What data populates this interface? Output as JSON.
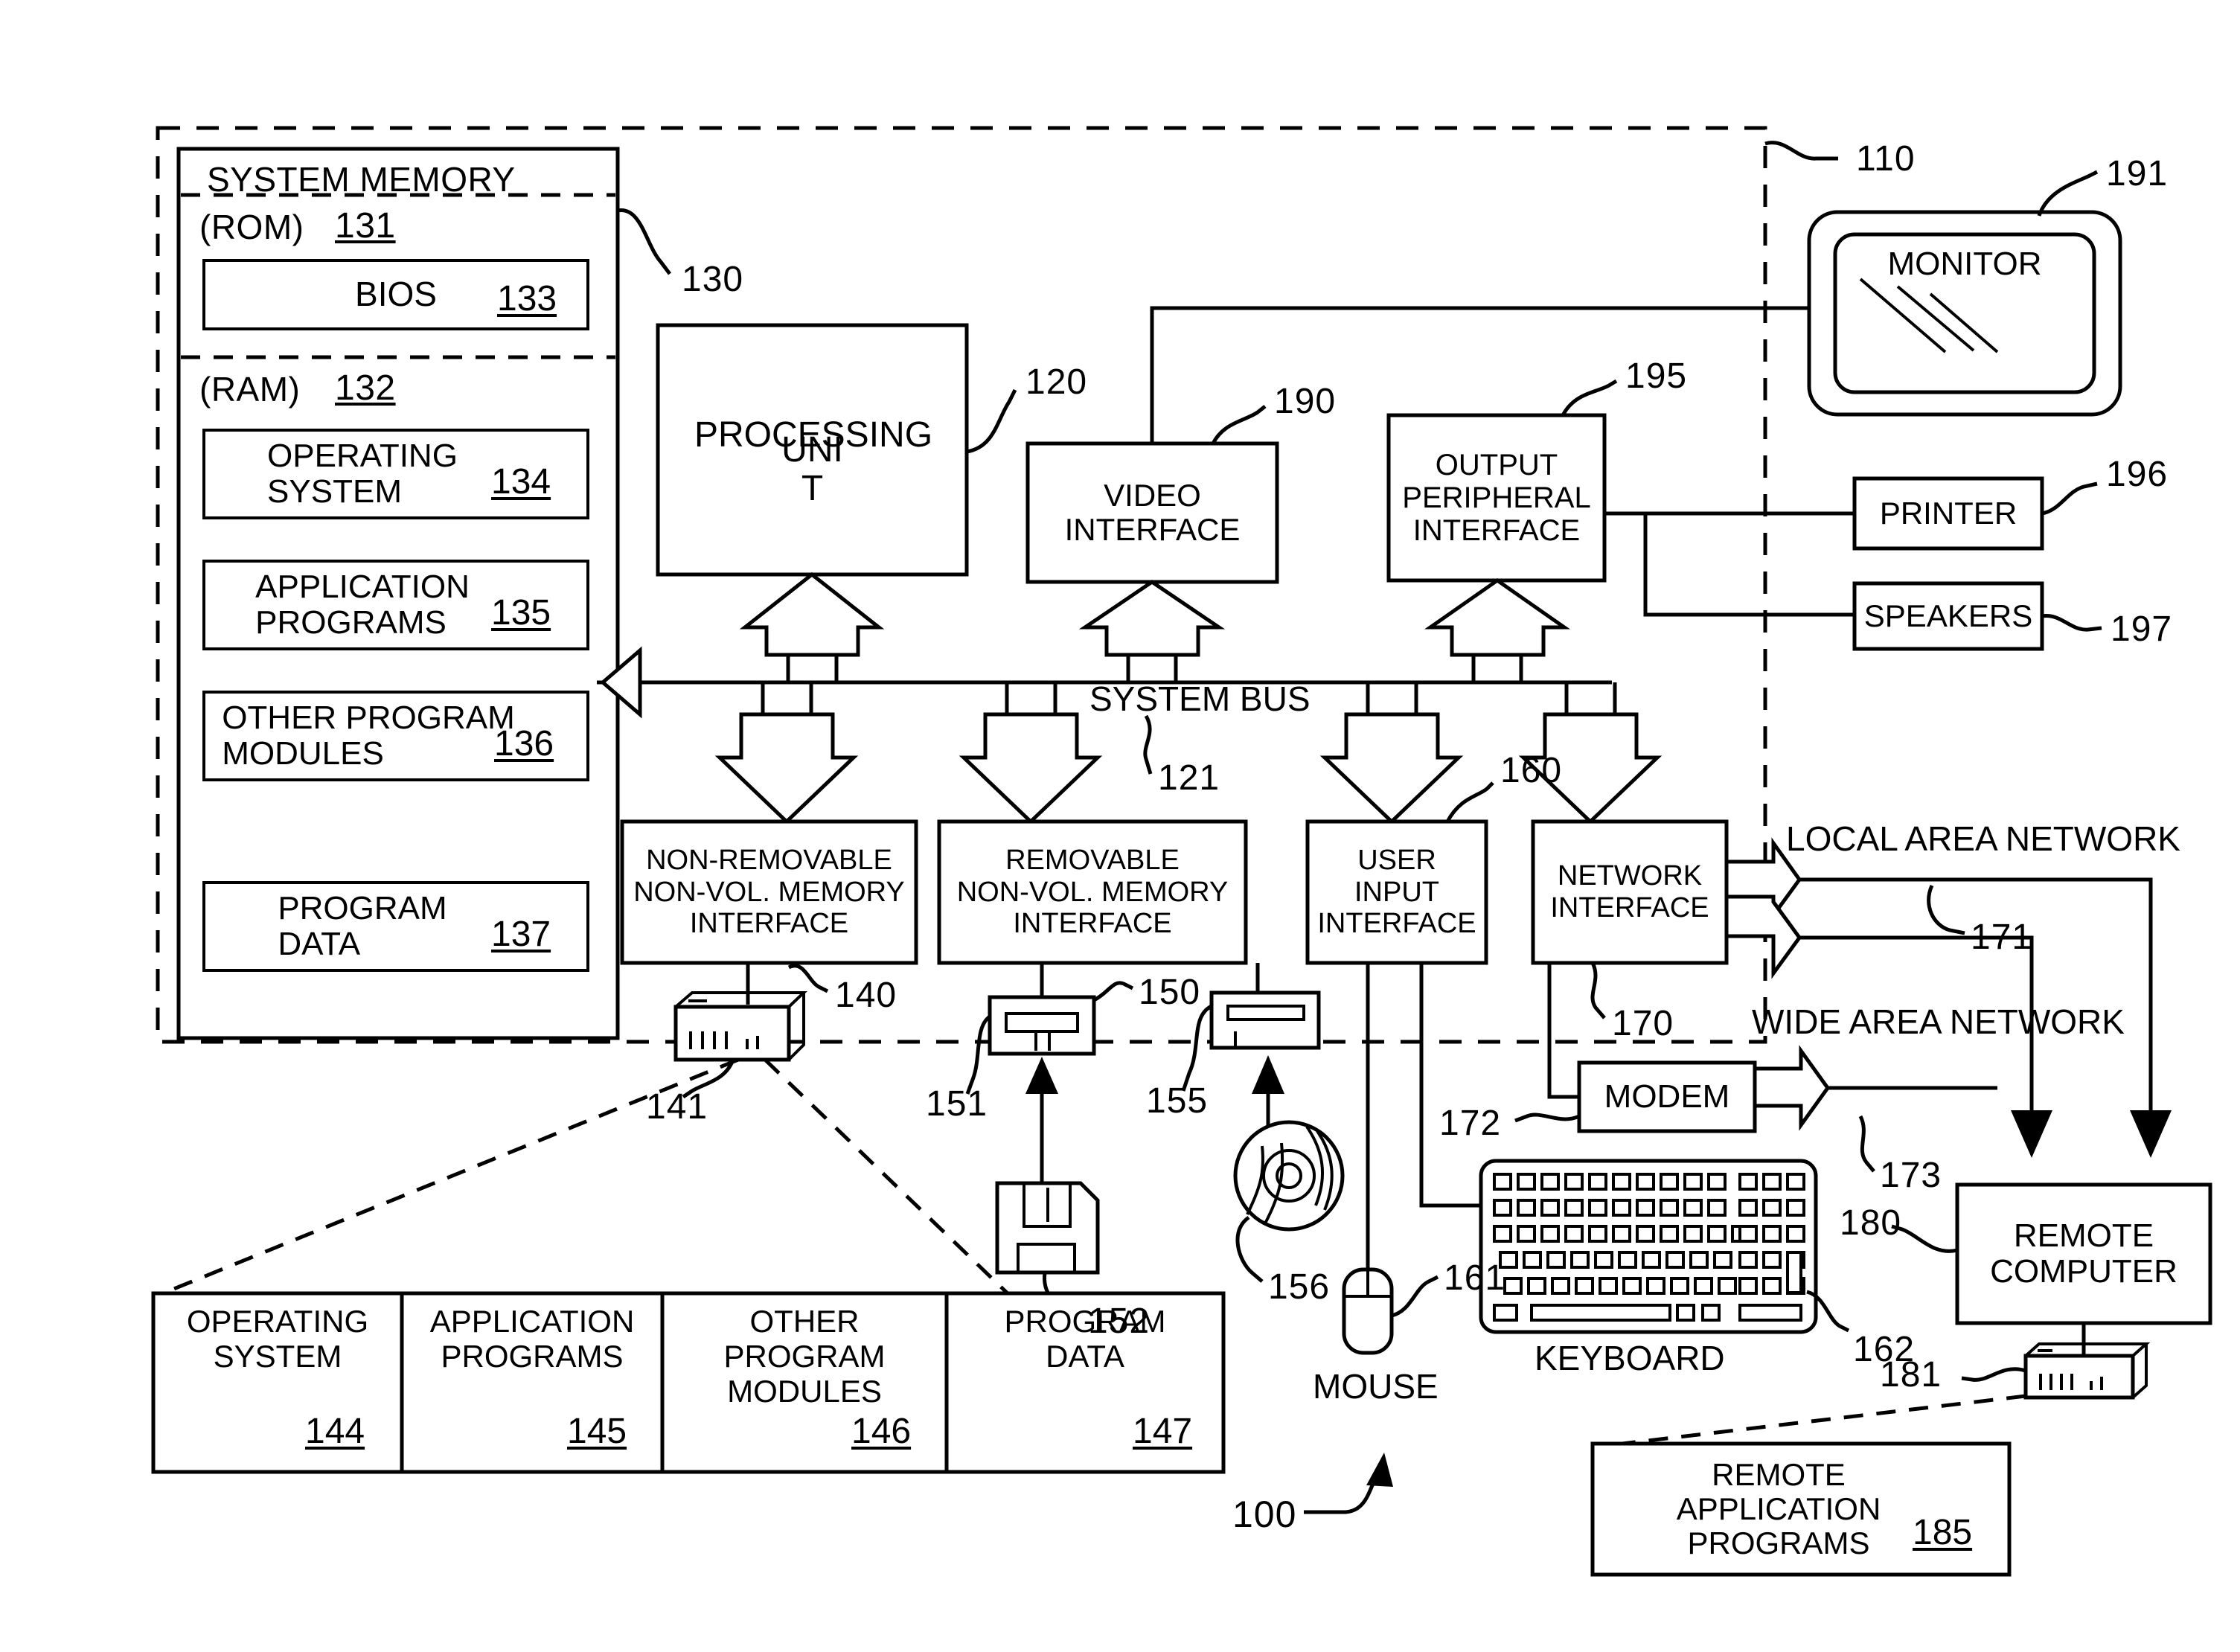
{
  "figure": {
    "overall_ref": "100",
    "computer_boundary_ref": "110",
    "bus_label": "SYSTEM BUS",
    "bus_ref": "121"
  },
  "system_memory": {
    "title": "SYSTEM MEMORY",
    "ref": "130",
    "rom": {
      "label": "(ROM)",
      "ref": "131"
    },
    "bios": {
      "label": "BIOS",
      "ref": "133"
    },
    "ram": {
      "label": "(RAM)",
      "ref": "132"
    },
    "items": [
      {
        "line1": "OPERATING",
        "line2": "SYSTEM",
        "ref": "134"
      },
      {
        "line1": "APPLICATION",
        "line2": "PROGRAMS",
        "ref": "135"
      },
      {
        "line1": "OTHER PROGRAM",
        "line2": "MODULES",
        "ref": "136"
      },
      {
        "line1": "PROGRAM",
        "line2": "DATA",
        "ref": "137"
      }
    ]
  },
  "processing_unit": {
    "line1": "PROCESSING",
    "line2": "UNI",
    "line3": "T",
    "ref": "120"
  },
  "interfaces": {
    "video": {
      "line1": "VIDEO",
      "line2": "INTERFACE",
      "ref": "190"
    },
    "output_peripheral": {
      "line1": "OUTPUT",
      "line2": "PERIPHERAL",
      "line3": "INTERFACE",
      "ref": "195"
    },
    "non_removable": {
      "line1": "NON-REMOVABLE",
      "line2": "NON-VOL. MEMORY",
      "line3": "INTERFACE",
      "ref": "140"
    },
    "removable": {
      "line1": "REMOVABLE",
      "line2": "NON-VOL. MEMORY",
      "line3": "INTERFACE",
      "ref": "150"
    },
    "user_input": {
      "line1": "USER",
      "line2": "INPUT",
      "line3": "INTERFACE",
      "ref": "160"
    },
    "network": {
      "line1": "NETWORK",
      "line2": "INTERFACE",
      "ref": "170"
    }
  },
  "peripherals": {
    "monitor": {
      "label": "MONITOR",
      "ref": "191"
    },
    "printer": {
      "label": "PRINTER",
      "ref": "196"
    },
    "speakers": {
      "label": "SPEAKERS",
      "ref": "197"
    },
    "keyboard": {
      "label": "KEYBOARD",
      "ref": "162"
    },
    "mouse": {
      "label": "MOUSE",
      "ref": "161"
    },
    "modem": {
      "label": "MODEM",
      "ref": "172"
    }
  },
  "storage_devices": {
    "hard_disk_ref": "141",
    "floppy_drive_ref": "151",
    "floppy_disk_ref": "152",
    "optical_drive_ref": "155",
    "optical_disc_ref": "156"
  },
  "networks": {
    "lan_label": "LOCAL AREA NETWORK",
    "lan_ref": "171",
    "wan_label": "WIDE AREA NETWORK",
    "wan_ref": "173"
  },
  "remote": {
    "computer": {
      "line1": "REMOTE",
      "line2": "COMPUTER",
      "ref": "180"
    },
    "memory_device_ref": "181",
    "application_programs": {
      "line1": "REMOTE",
      "line2": "APPLICATION",
      "line3": "PROGRAMS",
      "ref": "185"
    }
  },
  "exploded_storage": {
    "cells": [
      {
        "line1": "OPERATING",
        "line2": "SYSTEM",
        "ref": "144"
      },
      {
        "line1": "APPLICATION",
        "line2": "PROGRAMS",
        "ref": "145"
      },
      {
        "line1": "OTHER PROGRAM",
        "line2": "MODULES",
        "ref": "146"
      },
      {
        "line1": "PROGRAM",
        "line2": "DATA",
        "ref": "147"
      }
    ]
  },
  "colors": {
    "ink": "#000000",
    "paper": "#ffffff"
  }
}
